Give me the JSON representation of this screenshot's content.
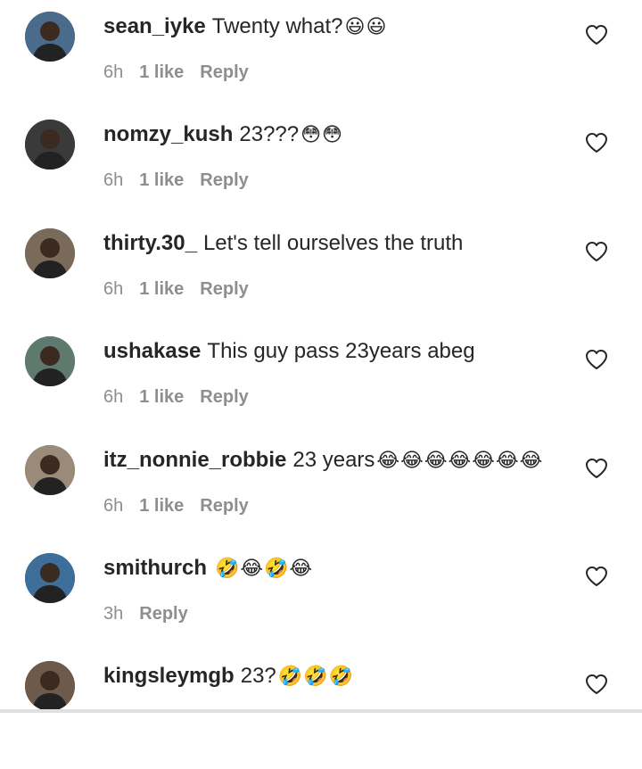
{
  "comments": [
    {
      "username": "sean_iyke",
      "text": "Twenty what?",
      "emojis": "😃😃",
      "time": "6h",
      "likes": "1 like",
      "reply": "Reply",
      "avatar_color": "#4a6b8c",
      "heart_icon": "heart-outline"
    },
    {
      "username": "nomzy_kush",
      "text": "23???",
      "emojis": "😳😳",
      "time": "6h",
      "likes": "1 like",
      "reply": "Reply",
      "avatar_color": "#3a3a3a",
      "heart_icon": "heart-outline"
    },
    {
      "username": "thirty.30_",
      "text": "Let's tell ourselves the truth",
      "emojis": "",
      "time": "6h",
      "likes": "1 like",
      "reply": "Reply",
      "avatar_color": "#7a6a5a",
      "heart_icon": "heart-outline"
    },
    {
      "username": "ushakase",
      "text": "This guy pass 23years abeg",
      "emojis": "",
      "time": "6h",
      "likes": "1 like",
      "reply": "Reply",
      "avatar_color": "#5e7a6e",
      "heart_icon": "heart-outline"
    },
    {
      "username": "itz_nonnie_robbie",
      "text": "23 years",
      "emojis": "😂😂😂😂😂😂😂",
      "time": "6h",
      "likes": "1 like",
      "reply": "Reply",
      "avatar_color": "#9a8a78",
      "heart_icon": "heart-outline"
    },
    {
      "username": "smithurch",
      "text": "",
      "emojis": "🤣😂🤣😂",
      "time": "3h",
      "likes": "",
      "reply": "Reply",
      "avatar_color": "#3d6f9a",
      "heart_icon": "heart-outline"
    },
    {
      "username": "kingsleymgb",
      "text": "23?",
      "emojis": "🤣🤣🤣",
      "time": "",
      "likes": "",
      "reply": "",
      "avatar_color": "#6e5a4a",
      "heart_icon": "heart-outline"
    }
  ]
}
